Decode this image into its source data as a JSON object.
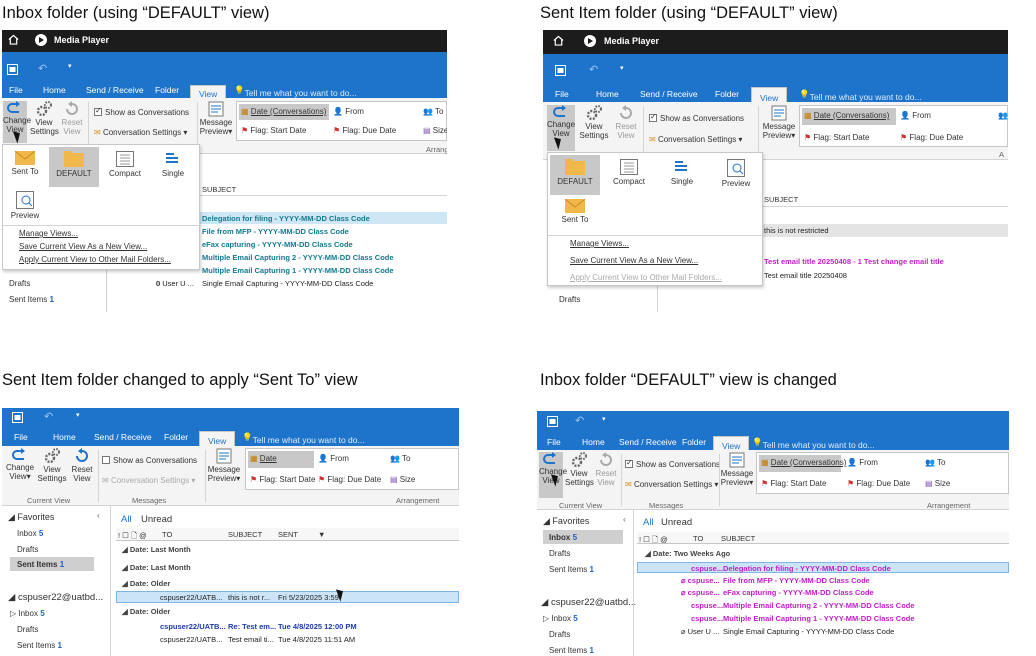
{
  "captions": [
    "Inbox folder (using “DEFAULT” view)",
    "Sent Item folder (using “DEFAULT” view)",
    "Sent Item folder changed to apply “Sent To” view",
    "Inbox folder “DEFAULT” view is changed"
  ],
  "media_player": {
    "title": "Media Player"
  },
  "tabs": {
    "file": "File",
    "home": "Home",
    "send_receive": "Send / Receive",
    "folder": "Folder",
    "view": "View",
    "tell_me": "Tell me what you want to do..."
  },
  "ribbon": {
    "change_view": "Change View",
    "change_view_1": "Change",
    "change_view_2": "View",
    "view_settings_1": "View",
    "view_settings_2": "Settings",
    "reset_view_1": "Reset",
    "reset_view_2": "View",
    "show_as_conversations": "Show as Conversations",
    "conversation_settings": "Conversation Settings",
    "message_preview_1": "Message",
    "message_preview_2": "Preview",
    "current_view_group": "Current View",
    "messages_group": "Messages",
    "arrangement_group": "Arrangement",
    "arrange_cut": "Arrang",
    "arrange_a": "A"
  },
  "arrangement": {
    "date_conversations": "Date (Conversations)",
    "date": "Date",
    "from": "From",
    "to": "To",
    "flag_start": "Flag: Start Date",
    "flag_due": "Flag: Due Date",
    "size": "Size",
    "size_cut": "Size"
  },
  "view_menu": {
    "sent_to": "Sent To",
    "default": "DEFAULT",
    "compact": "Compact",
    "single": "Single",
    "preview": "Preview",
    "manage": "Manage Views...",
    "save": "Save Current View As a New View...",
    "apply": "Apply Current View to Other Mail Folders..."
  },
  "p1": {
    "subject_header": "SUBJECT",
    "rows": [
      "Delegation for filing - YYYY-MM-DD Class Code",
      "File from MFP - YYYY-MM-DD Class Code",
      "eFax capturing - YYYY-MM-DD Class Code",
      "Multiple Email Capturing 2 - YYYY-MM-DD Class Code",
      "Multiple Email Capturing 1 - YYYY-MM-DD Class Code",
      "Single Email Capturing - YYYY-MM-DD Class Code"
    ],
    "last_row_from": "User U ...",
    "drafts": "Drafts",
    "sent_items": "Sent Items",
    "sent_count": "1"
  },
  "p2": {
    "subject_header": "SUBJECT",
    "rows": [
      "this is not restricted",
      "Test email title 20250408 - 1 Test change email title",
      "Test email title 20250408"
    ],
    "drafts": "Drafts"
  },
  "p3": {
    "favorites": "Favorites",
    "inbox": "Inbox",
    "inbox_count": "5",
    "drafts": "Drafts",
    "sent_items": "Sent Items",
    "sent_count": "1",
    "account": "cspuser22@uatbd...",
    "inbox2": "Inbox",
    "inbox2_count": "5",
    "drafts2": "Drafts",
    "sent_items2": "Sent Items",
    "sent2_count": "1",
    "all": "All",
    "unread": "Unread",
    "col_icons": "! ☐ 🗋 @",
    "col_to": "TO",
    "col_subject": "SUBJECT",
    "col_sent": "SENT",
    "groups": [
      "Date: Last Month",
      "Date: Last Month",
      "Date: Older",
      "Date: Older"
    ],
    "row1": {
      "to": "cspuser22/UATB...",
      "subject": "this is not r...",
      "sent": "Fri 5/23/2025 3:59"
    },
    "row2": {
      "to": "cspuser22/UATB...",
      "subject": "Re: Test em...",
      "sent": "Tue 4/8/2025 12:00 PM"
    },
    "row3": {
      "to": "cspuser22/UATB...",
      "subject": "Test email ti...",
      "sent": "Tue 4/8/2025 11:51 AM"
    }
  },
  "p4": {
    "favorites": "Favorites",
    "inbox": "Inbox",
    "inbox_count": "5",
    "drafts": "Drafts",
    "sent_items": "Sent Items",
    "sent_count": "1",
    "account": "cspuser22@uatbd...",
    "inbox2": "Inbox",
    "inbox2_count": "5",
    "drafts2": "Drafts",
    "sent_items2": "Sent Items",
    "sent2_count": "1",
    "all": "All",
    "unread": "Unread",
    "col_to": "TO",
    "col_subject": "SUBJECT",
    "group": "Date: Two Weeks Ago",
    "from_short": "cspuse...",
    "rows": [
      "Delegation for filing - YYYY-MM-DD Class Code",
      "File from MFP - YYYY-MM-DD Class Code",
      "eFax capturing - YYYY-MM-DD Class Code",
      "Multiple Email Capturing 2 - YYYY-MM-DD Class Code",
      "Multiple Email Capturing 1 - YYYY-MM-DD Class Code",
      "Single Email Capturing - YYYY-MM-DD Class Code"
    ],
    "last_from": "User U ..."
  },
  "colors": {
    "outlook_blue": "#1e73cb",
    "teal_unread": "#127a8f",
    "magenta_unread": "#c11fc7",
    "selected_row": "#cce4f7"
  }
}
